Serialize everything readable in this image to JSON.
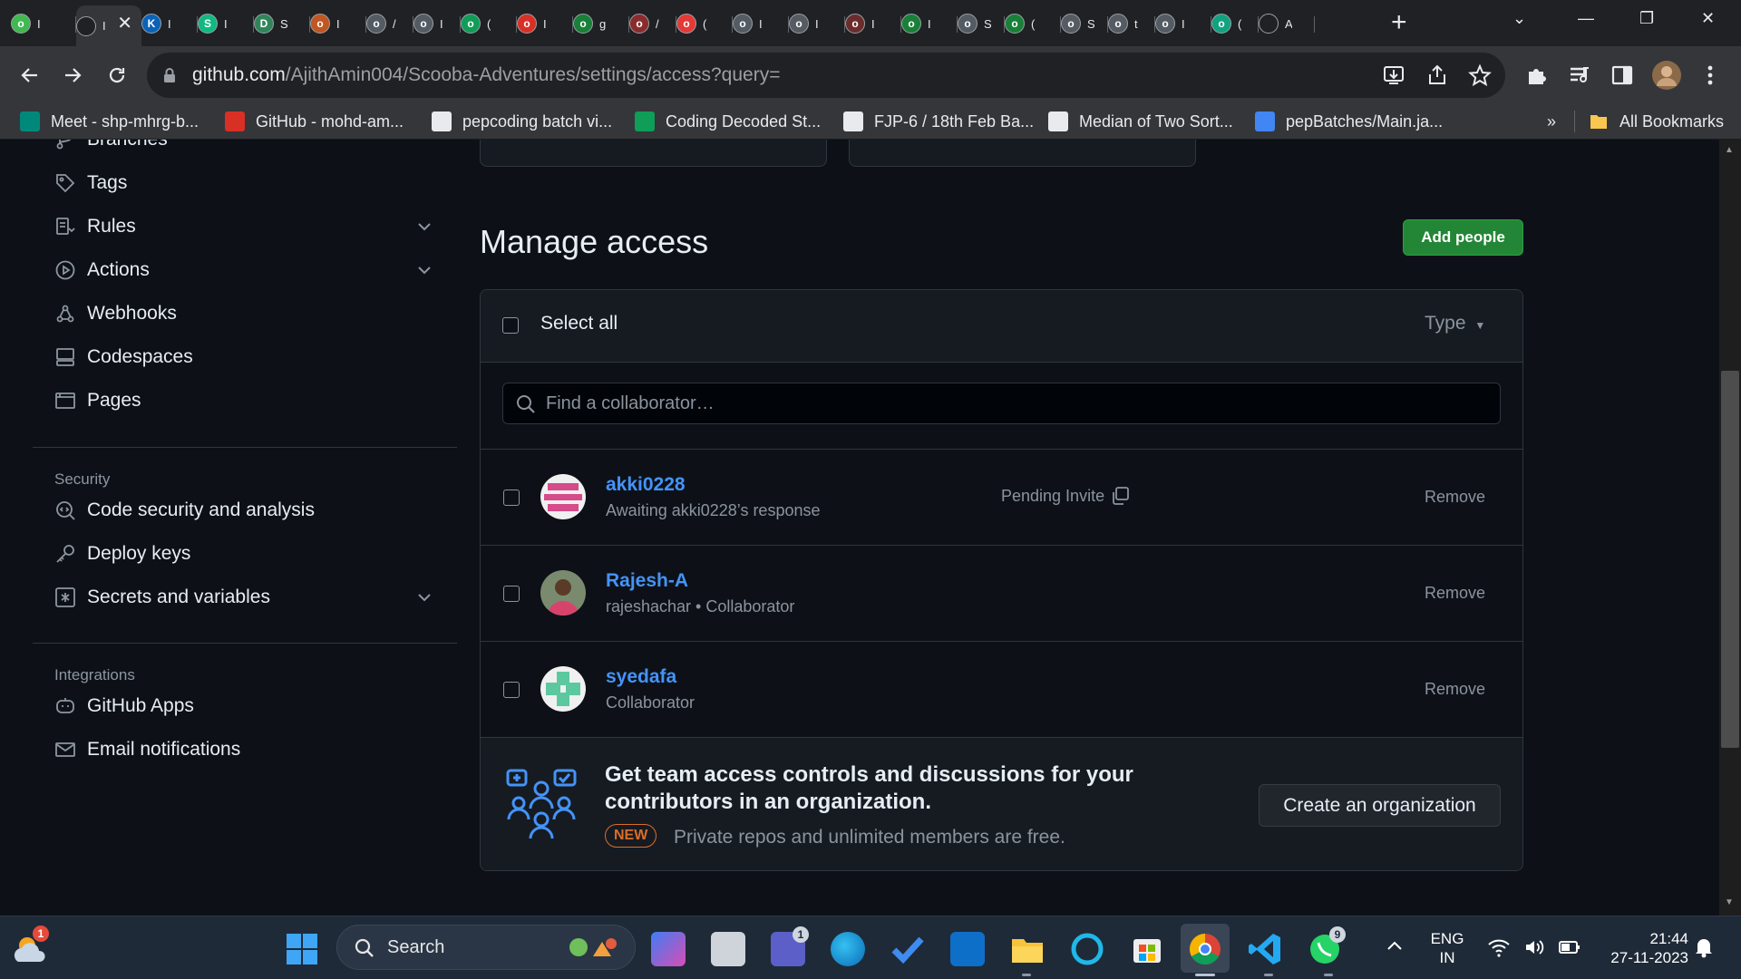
{
  "browser": {
    "tabs": [
      {
        "title": "I",
        "color": "#3fb950",
        "glyph": "o"
      },
      {
        "title": "I",
        "color": "#202124",
        "glyph": ""
      },
      {
        "title": "I",
        "color": "#0b63b7",
        "glyph": "K"
      },
      {
        "title": "I",
        "color": "#10b981",
        "glyph": "S"
      },
      {
        "title": "S",
        "color": "#2f855a",
        "glyph": "D"
      },
      {
        "title": "I",
        "color": "#c05621",
        "glyph": "o"
      },
      {
        "title": "/",
        "color": "#555b63",
        "glyph": "o"
      },
      {
        "title": "I",
        "color": "#555b63",
        "glyph": "o"
      },
      {
        "title": "(",
        "color": "#0f9d58",
        "glyph": "o"
      },
      {
        "title": "I",
        "color": "#d93025",
        "glyph": "o"
      },
      {
        "title": "g",
        "color": "#188038",
        "glyph": "o"
      },
      {
        "title": "/",
        "color": "#8b2c2c",
        "glyph": "o"
      },
      {
        "title": "(",
        "color": "#e53935",
        "glyph": "o"
      },
      {
        "title": "I",
        "color": "#555b63",
        "glyph": "o"
      },
      {
        "title": "I",
        "color": "#555b63",
        "glyph": "o"
      },
      {
        "title": "I",
        "color": "#6b2c2c",
        "glyph": "o"
      },
      {
        "title": "I",
        "color": "#188038",
        "glyph": "o"
      },
      {
        "title": "S",
        "color": "#555b63",
        "glyph": "o"
      },
      {
        "title": "(",
        "color": "#188038",
        "glyph": "o"
      },
      {
        "title": "S",
        "color": "#555b63",
        "glyph": "o"
      },
      {
        "title": "t",
        "color": "#555b63",
        "glyph": "o"
      },
      {
        "title": "I",
        "color": "#555b63",
        "glyph": "o"
      },
      {
        "title": "(",
        "color": "#10a37f",
        "glyph": "o"
      },
      {
        "title": "A",
        "color": "#202124",
        "glyph": ""
      }
    ],
    "active_tab_close": "✕",
    "new_tab": "+",
    "url_host": "github.com",
    "url_path": "/AjithAmin004/Scooba-Adventures/settings/access?query=",
    "bookmarks": [
      {
        "label": "Meet - shp-mhrg-b...",
        "color": "#00897b"
      },
      {
        "label": "GitHub - mohd-am...",
        "color": "#d93025"
      },
      {
        "label": "pepcoding batch vi...",
        "color": "#e8eaed"
      },
      {
        "label": "Coding Decoded St...",
        "color": "#0f9d58"
      },
      {
        "label": "FJP-6 / 18th Feb Ba...",
        "color": "#e8eaed"
      },
      {
        "label": "Median of Two Sort...",
        "color": "#e8eaed"
      },
      {
        "label": "pepBatches/Main.ja...",
        "color": "#4285f4"
      }
    ],
    "bookmarks_more": "»",
    "all_bookmarks": "All Bookmarks"
  },
  "sidebar": {
    "items": [
      {
        "label": "Branches",
        "icon": "branch-icon"
      },
      {
        "label": "Tags",
        "icon": "tag-icon"
      },
      {
        "label": "Rules",
        "icon": "rules-icon",
        "expand": true
      },
      {
        "label": "Actions",
        "icon": "play-icon",
        "expand": true
      },
      {
        "label": "Webhooks",
        "icon": "webhook-icon"
      },
      {
        "label": "Codespaces",
        "icon": "codespaces-icon"
      },
      {
        "label": "Pages",
        "icon": "browser-icon"
      }
    ],
    "security_heading": "Security",
    "security_items": [
      {
        "label": "Code security and analysis",
        "icon": "codescan-icon"
      },
      {
        "label": "Deploy keys",
        "icon": "key-icon"
      },
      {
        "label": "Secrets and variables",
        "icon": "asterisk-icon",
        "expand": true
      }
    ],
    "integrations_heading": "Integrations",
    "integration_items": [
      {
        "label": "GitHub Apps",
        "icon": "app-icon"
      },
      {
        "label": "Email notifications",
        "icon": "mail-icon"
      }
    ]
  },
  "main": {
    "title": "Manage access",
    "add_people": "Add people",
    "select_all": "Select all",
    "type_filter": "Type",
    "search_placeholder": "Find a collaborator…",
    "collaborators": [
      {
        "name": "akki0228",
        "sub": "Awaiting akki0228’s response",
        "pending": "Pending Invite",
        "remove": "Remove",
        "avatar": "pink-identicon"
      },
      {
        "name": "Rajesh-A",
        "sub": "rajeshachar • Collaborator",
        "pending": "",
        "remove": "Remove",
        "avatar": "photo"
      },
      {
        "name": "syedafa",
        "sub": "Collaborator",
        "pending": "",
        "remove": "Remove",
        "avatar": "green-identicon"
      }
    ],
    "promo_title": "Get team access controls and discussions for your contributors in an organization.",
    "promo_badge": "NEW",
    "promo_text": "Private repos and unlimited members are free.",
    "create_org": "Create an organization"
  },
  "taskbar": {
    "search_label": "Search",
    "lang_top": "ENG",
    "lang_bottom": "IN",
    "time": "21:44",
    "date": "27-11-2023",
    "weather_badge": "1",
    "teams_badge": "1",
    "whatsapp_badge": "9"
  },
  "colors": {
    "accent": "#238636",
    "link": "#4493f8",
    "badge_new": "#db6d28"
  }
}
